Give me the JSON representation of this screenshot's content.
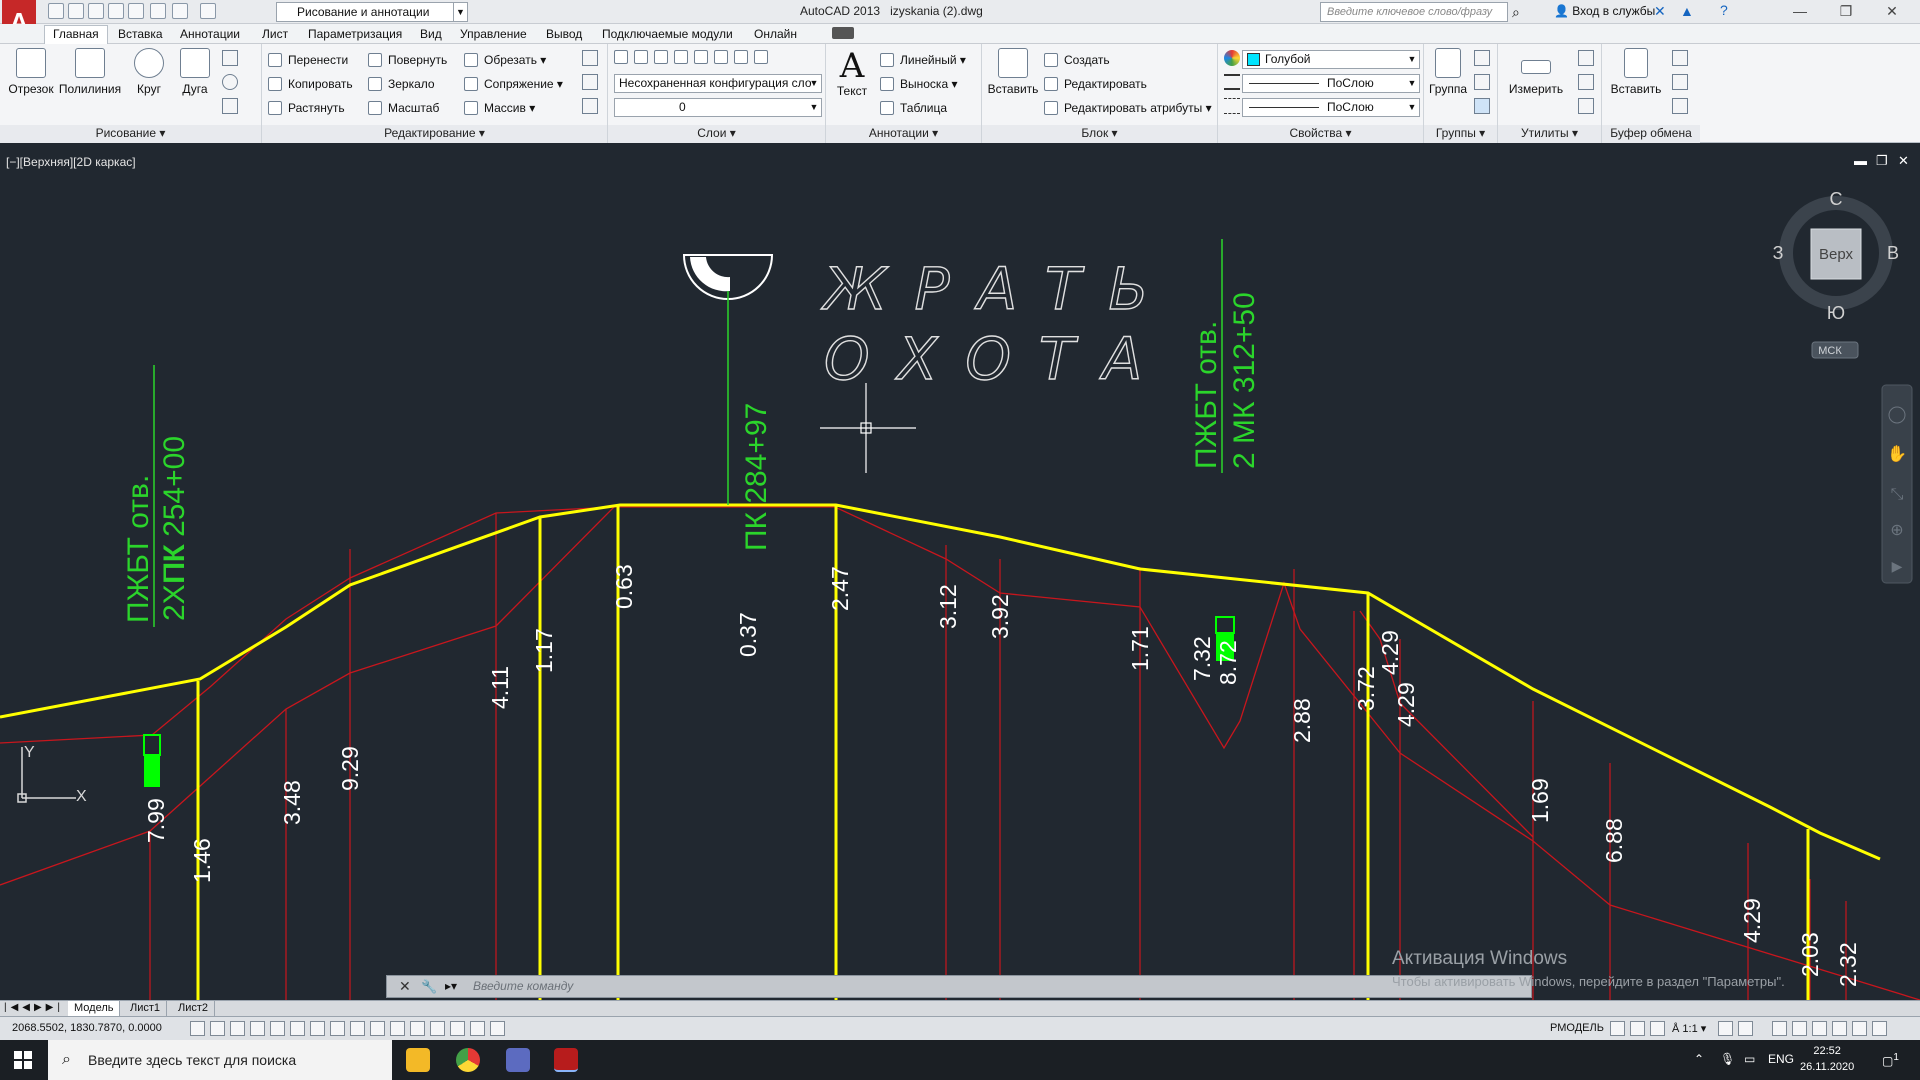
{
  "titlebar": {
    "app_title": "AutoCAD 2013",
    "file_name": "izyskania (2).dwg",
    "workspace": "Рисование и аннотации",
    "search_placeholder": "Введите ключевое слово/фразу",
    "login": "Вход в службы"
  },
  "menu_tabs": [
    "Главная",
    "Вставка",
    "Аннотации",
    "Лист",
    "Параметризация",
    "Вид",
    "Управление",
    "Вывод",
    "Подключаемые модули",
    "Онлайн"
  ],
  "ribbon": {
    "draw": {
      "title": "Рисование",
      "line": "Отрезок",
      "polyline": "Полилиния",
      "circle": "Круг",
      "arc": "Дуга"
    },
    "modify": {
      "title": "Редактирование",
      "move": "Перенести",
      "rotate": "Повернуть",
      "trim": "Обрезать",
      "copy": "Копировать",
      "mirror": "Зеркало",
      "fillet": "Сопряжение",
      "stretch": "Растянуть",
      "scale": "Масштаб",
      "array": "Массив"
    },
    "layers": {
      "title": "Слои",
      "state": "Несохраненная конфигурация сло",
      "current": "0"
    },
    "annotation": {
      "title": "Аннотации",
      "text": "Текст",
      "linear": "Линейный",
      "leader": "Выноска",
      "table": "Таблица"
    },
    "block": {
      "title": "Блок",
      "insert": "Вставить",
      "create": "Создать",
      "edit": "Редактировать",
      "edit_attr": "Редактировать атрибуты"
    },
    "properties": {
      "title": "Свойства",
      "color": "Голубой",
      "linetype": "ПоСлою",
      "lineweight": "ПоСлою",
      "color_hex": "#00e5ff"
    },
    "groups": {
      "title": "Группы",
      "group": "Группа"
    },
    "utilities": {
      "title": "Утилиты",
      "measure": "Измерить"
    },
    "clipboard": {
      "title": "Буфер обмена",
      "paste": "Вставить"
    }
  },
  "viewport": {
    "label": "[−][Верхняя][2D каркас]",
    "viewcube": {
      "n": "С",
      "s": "Ю",
      "e": "В",
      "w": "З",
      "face": "Верх",
      "ucs": "МСК"
    },
    "ucs_y": "Y",
    "ucs_x": "X"
  },
  "drawing": {
    "stamp1": [
      "ПЖБТ отв.",
      "2ХПК 254+00"
    ],
    "stamp1_overlap": "ПК",
    "stamp2": [
      "ПЖБТ отв.",
      "2 МК 312+50"
    ],
    "pk_label": "ПК 284+97",
    "title1": "ЖРАТЬ",
    "title2": "ОХОТА",
    "labels": [
      "7.99",
      "1.46",
      "3.48",
      "9.29",
      "4.11",
      "1.17",
      "0.63",
      "0.37",
      "2.47",
      "3.12",
      "3.92",
      "1.71",
      "7.32",
      "8.72",
      "2.88",
      "3.72",
      "4.29",
      "4.29",
      "1.69",
      "6.88",
      "4.29",
      "2.03",
      "2.32"
    ],
    "colors": {
      "ground": "#ffff00",
      "design": "#c8161d",
      "text": "#ffffff",
      "annot": "#2bd52b",
      "marker": "#00ff00"
    }
  },
  "command_line": {
    "prompt": "Введите команду"
  },
  "activation": {
    "title": "Активация Windows",
    "subtitle": "Чтобы активировать Windows, перейдите в раздел \"Параметры\"."
  },
  "layout_tabs": [
    "Модель",
    "Лист1",
    "Лист2"
  ],
  "status": {
    "coords": "2068.5502, 1830.7870, 0.0000",
    "model": "РМОДЕЛЬ",
    "scale": "1:1"
  },
  "taskbar": {
    "search": "Введите здесь текст для поиска",
    "lang": "ENG",
    "time": "22:52",
    "date": "26.11.2020",
    "notif": "1"
  }
}
